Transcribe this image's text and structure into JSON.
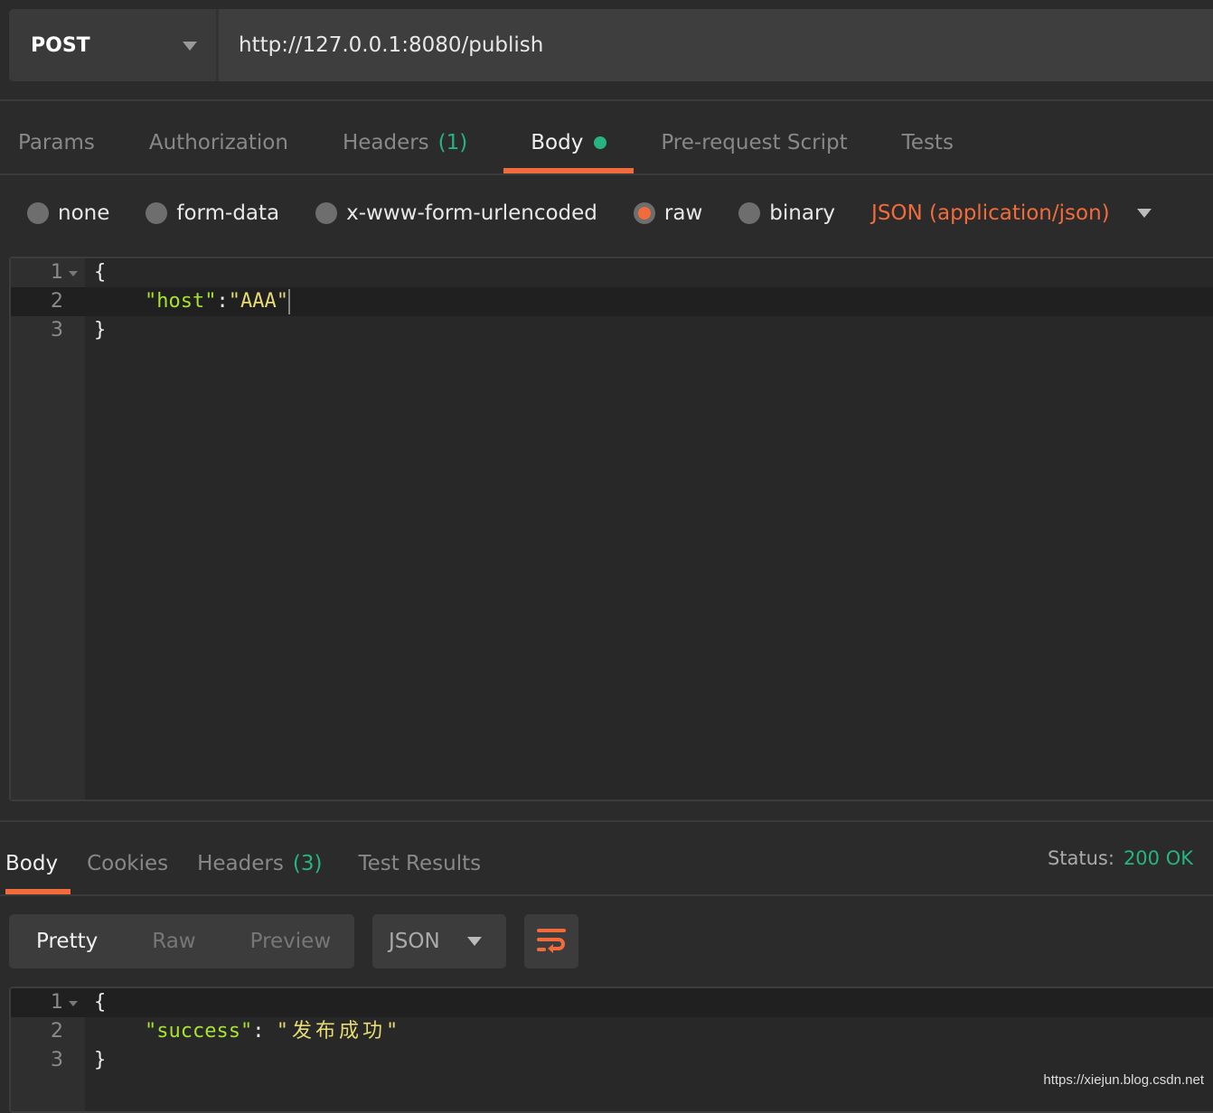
{
  "request": {
    "method": "POST",
    "url": "http://127.0.0.1:8080/publish",
    "tabs": [
      {
        "label": "Params"
      },
      {
        "label": "Authorization"
      },
      {
        "label": "Headers",
        "count": "(1)"
      },
      {
        "label": "Body",
        "active": true
      },
      {
        "label": "Pre-request Script"
      },
      {
        "label": "Tests"
      }
    ],
    "body_modes": [
      "none",
      "form-data",
      "x-www-form-urlencoded",
      "raw",
      "binary"
    ],
    "selected_mode": "raw",
    "content_type": "JSON (application/json)",
    "editor": {
      "lines": [
        {
          "n": "1",
          "brace": "{"
        },
        {
          "n": "2",
          "key": "\"host\"",
          "sep": ":",
          "value": "\"AAA\""
        },
        {
          "n": "3",
          "brace": "}"
        }
      ]
    }
  },
  "response": {
    "tabs": [
      {
        "label": "Body",
        "active": true
      },
      {
        "label": "Cookies"
      },
      {
        "label": "Headers",
        "count": "(3)"
      },
      {
        "label": "Test Results"
      }
    ],
    "status_label": "Status:",
    "status_value": "200 OK",
    "view_modes": [
      "Pretty",
      "Raw",
      "Preview"
    ],
    "format": "JSON",
    "wrap_icon": "wrap-lines-icon",
    "editor": {
      "lines": [
        {
          "n": "1",
          "brace": "{"
        },
        {
          "n": "2",
          "key": "\"success\"",
          "sep": ": ",
          "value": "\"发布成功\""
        },
        {
          "n": "3",
          "brace": "}"
        }
      ]
    }
  },
  "watermark": "https://xiejun.blog.csdn.net",
  "colors": {
    "accent": "#f26b3a",
    "success": "#26b47f",
    "json_key": "#a6e22e",
    "json_string": "#e6db74"
  }
}
